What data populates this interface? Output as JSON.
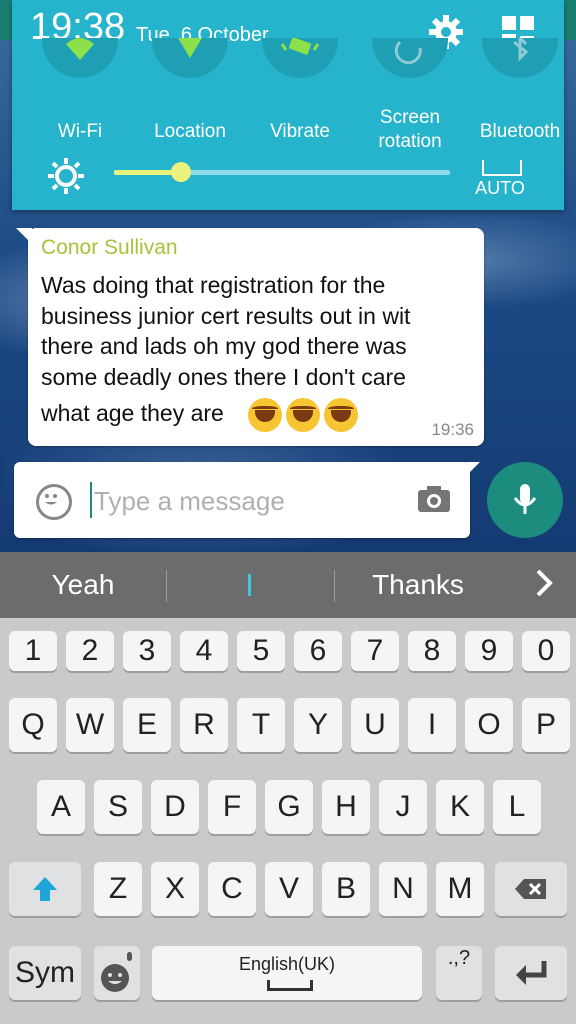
{
  "status": {
    "time": "19:38",
    "date": "Tue, 6 October"
  },
  "quick_settings": [
    {
      "label": "Wi-Fi",
      "icon": "wifi-icon"
    },
    {
      "label": "Location",
      "icon": "location-icon"
    },
    {
      "label": "Vibrate",
      "icon": "vibrate-icon"
    },
    {
      "label": "Screen rotation",
      "icon": "screen-rotation-icon"
    },
    {
      "label": "Bluetooth",
      "icon": "bluetooth-icon"
    }
  ],
  "brightness": {
    "level": 0.2,
    "auto_label": "AUTO"
  },
  "chat": {
    "sender": "Conor Sullivan",
    "message_lines": [
      "Was doing that registration for the",
      "business junior cert results out in wit",
      "there and lads oh my god there was",
      "some deadly ones there I don't care"
    ],
    "message_last": "what age they are",
    "emoji": [
      "laughing-crying-emoji",
      "laughing-crying-emoji",
      "laughing-crying-emoji"
    ],
    "time": "19:36"
  },
  "composer": {
    "placeholder": "Type a message"
  },
  "suggestions": {
    "left": "Yeah",
    "middle": "I",
    "right": "Thanks"
  },
  "keyboard": {
    "numbers": [
      "1",
      "2",
      "3",
      "4",
      "5",
      "6",
      "7",
      "8",
      "9",
      "0"
    ],
    "row1": [
      "Q",
      "W",
      "E",
      "R",
      "T",
      "Y",
      "U",
      "I",
      "O",
      "P"
    ],
    "row2": [
      "A",
      "S",
      "D",
      "F",
      "G",
      "H",
      "J",
      "K",
      "L"
    ],
    "row3": [
      "Z",
      "X",
      "C",
      "V",
      "B",
      "N",
      "M"
    ],
    "sym": "Sym",
    "space": "English(UK)",
    "punct": ".,?"
  },
  "colors": {
    "panel": "#26b4cc",
    "accent": "#1b8c7e",
    "sender": "#a8c23a",
    "slider": "#e9f27a"
  }
}
